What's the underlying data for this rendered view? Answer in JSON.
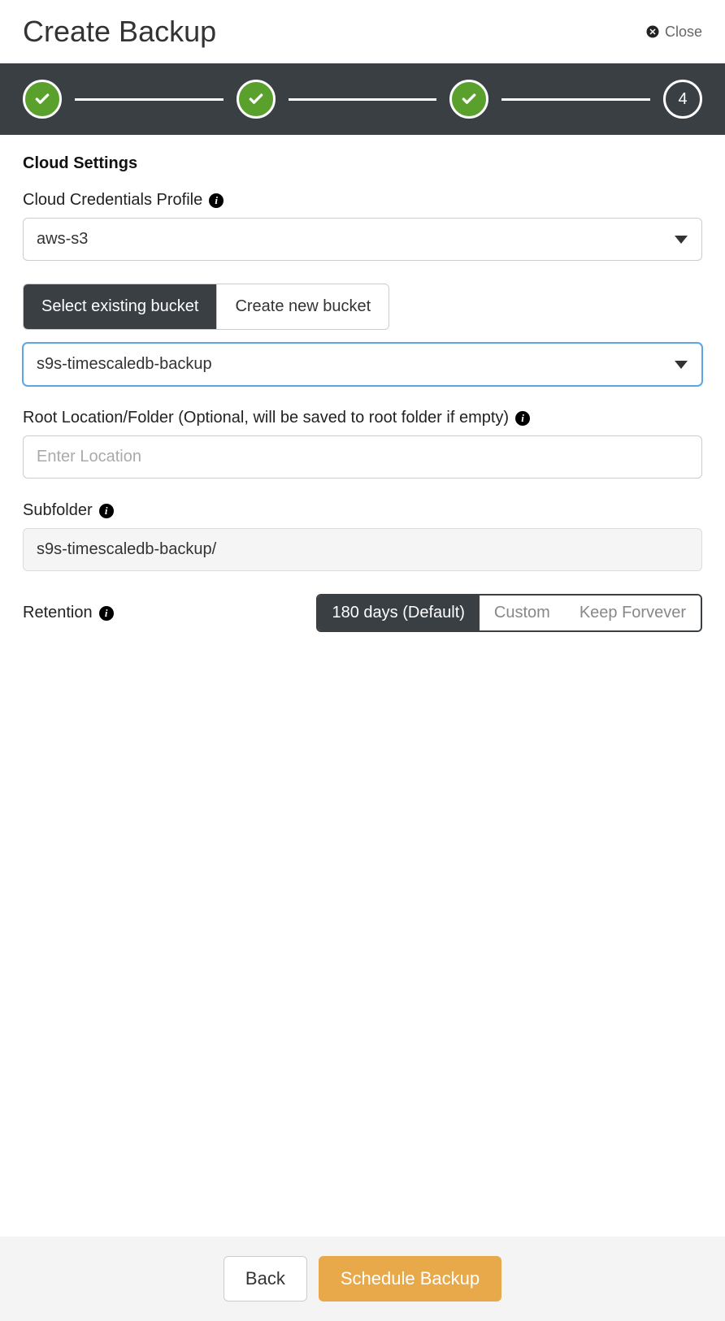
{
  "header": {
    "title": "Create Backup",
    "close_label": "Close"
  },
  "stepper": {
    "steps": [
      {
        "state": "done"
      },
      {
        "state": "done"
      },
      {
        "state": "done"
      },
      {
        "state": "current",
        "label": "4"
      }
    ]
  },
  "section_title": "Cloud Settings",
  "credentials": {
    "label": "Cloud Credentials Profile",
    "value": "aws-s3"
  },
  "bucket_tabs": {
    "existing": "Select existing bucket",
    "create": "Create new bucket",
    "active": "existing"
  },
  "bucket_select": {
    "value": "s9s-timescaledb-backup"
  },
  "root_location": {
    "label": "Root Location/Folder (Optional, will be saved to root folder if empty)",
    "placeholder": "Enter Location",
    "value": ""
  },
  "subfolder": {
    "label": "Subfolder",
    "value": "s9s-timescaledb-backup/"
  },
  "retention": {
    "label": "Retention",
    "options": {
      "default": "180 days (Default)",
      "custom": "Custom",
      "forever": "Keep Forvever"
    },
    "active": "default"
  },
  "footer": {
    "back": "Back",
    "submit": "Schedule Backup"
  }
}
